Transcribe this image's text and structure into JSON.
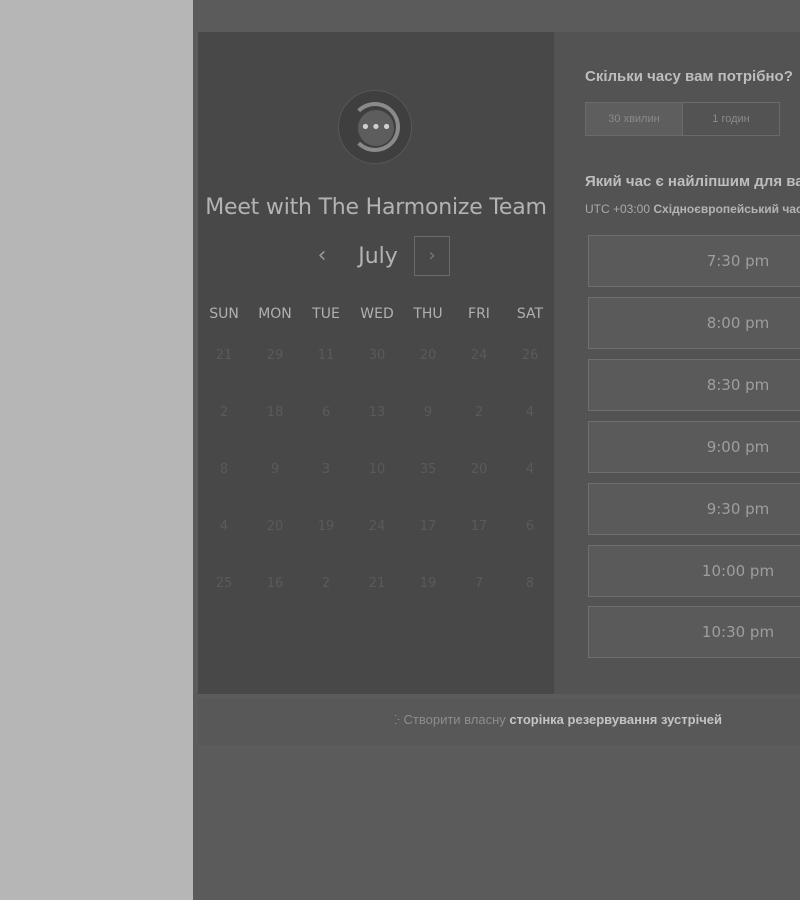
{
  "booking": {
    "team_name": "Meet with The Harmonize Team",
    "logo_glyph": "•••",
    "calendar": {
      "month": "July",
      "prev_glyph": "‹",
      "next_glyph": "›",
      "weekdays": [
        "SUN",
        "MON",
        "TUE",
        "WED",
        "THU",
        "FRI",
        "SAT"
      ],
      "weeks": [
        [
          "21",
          "29",
          "11",
          "30",
          "20",
          "24",
          "26"
        ],
        [
          "2",
          "18",
          "6",
          "13",
          "9",
          "2",
          "4"
        ],
        [
          "8",
          "9",
          "3",
          "10",
          "35",
          "20",
          "4"
        ],
        [
          "4",
          "20",
          "19",
          "24",
          "17",
          "17",
          "6"
        ],
        [
          "25",
          "16",
          "2",
          "21",
          "19",
          "7",
          "8"
        ]
      ]
    },
    "duration": {
      "question": "Скільки часу вам потрібно?",
      "options": [
        "30 хвилин",
        "1 годин"
      ],
      "selected": "30 хвилин"
    },
    "time": {
      "question": "Який час є найліпшим для вас?",
      "timezone_offset": "UTC +03:00",
      "timezone_name": "Східноєвропейський час",
      "slots": [
        "7:30 pm",
        "8:00 pm",
        "8:30 pm",
        "9:00 pm",
        "9:30 pm",
        "10:00 pm",
        "10:30 pm"
      ]
    }
  },
  "footer": {
    "icon": "sprout-icon",
    "prefix": "Створити власну",
    "link": "сторінка резервування зустрічей"
  },
  "colors": {
    "overlay_bg": "#5b5b5b",
    "left_panel": "#484848",
    "right_panel": "#535353",
    "outer_margin": "#b6b6b6"
  }
}
